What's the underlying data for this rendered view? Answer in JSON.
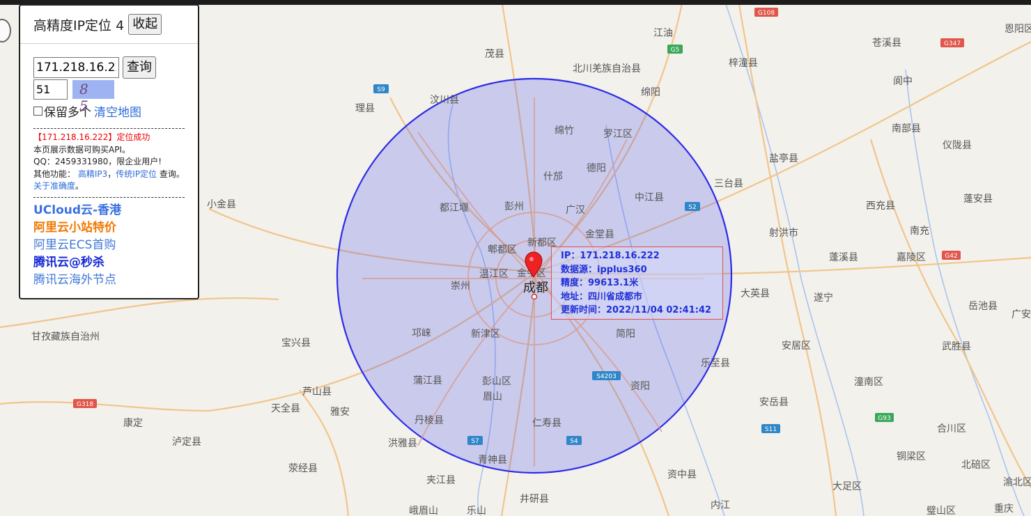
{
  "panel": {
    "title": "高精度IP定位 4",
    "collapse_label": "收起",
    "ip_value": "171.218.16.222",
    "query_label": "查询",
    "code_value": "51",
    "captcha_text": "8 5",
    "keep_label": "保留多个",
    "clear_label": "清空地图",
    "result_text": "【171.218.16.222】定位成功",
    "line1": "本页展示数据可购买API。",
    "line2": "QQ：2459331980，限企业用户!",
    "line3_prefix": "其他功能：",
    "link_hp": "高精IP3",
    "sep": "，",
    "link_trad": "传统IP定位",
    "line3_suffix": "查询。",
    "link_accuracy": "关于准确度",
    "line3_end": "。",
    "ads": [
      "UCloud云-香港",
      "阿里云小站特价",
      "阿里云ECS首购",
      "腾讯云@秒杀",
      "腾讯云海外节点"
    ]
  },
  "infobox": {
    "ip": "IP：171.218.16.222",
    "source": "数据源：ipplus360",
    "accuracy": "精度：99613.1米",
    "address": "地址：四川省成都市",
    "updated": "更新时间：2022/11/04 02:41:42"
  },
  "map": {
    "center_city": "成都",
    "accuracy_meters": 99613.1,
    "circle_color": "#2b2be8",
    "circle_fill": "#c8caf6",
    "place_labels": [
      "茂县",
      "北川羌族自治县",
      "江油",
      "梓潼县",
      "苍溪县",
      "恩阳区",
      "汶川县",
      "理县",
      "绵阳",
      "阆中",
      "绵竹",
      "罗江区",
      "南部县",
      "盐亭县",
      "仪陇县",
      "什邡",
      "德阳",
      "三台县",
      "都江堰",
      "彭州",
      "广汉",
      "中江县",
      "西充县",
      "蓬安县",
      "金堂县",
      "射洪市",
      "南充",
      "郫都区",
      "新都区",
      "金牛区",
      "蓬溪县",
      "嘉陵区",
      "温江区",
      "崇州",
      "成都",
      "大英县",
      "遂宁",
      "岳池县",
      "广安",
      "甘孜藏族自治州",
      "宝兴县",
      "邛崃",
      "新津区",
      "简阳",
      "安居区",
      "武胜县",
      "乐至县",
      "蒲江县",
      "彭山区",
      "芦山县",
      "潼南区",
      "天全县",
      "雅安",
      "眉山",
      "资阳",
      "安岳县",
      "康定",
      "丹棱县",
      "泸定县",
      "洪雅县",
      "仁寿县",
      "合川区",
      "青神县",
      "荥经县",
      "铜梁区",
      "北碚区",
      "夹江县",
      "资中县",
      "井研县",
      "大足区",
      "渝北区",
      "峨眉山",
      "乐山",
      "内江",
      "璧山区",
      "重庆",
      "小金县"
    ],
    "road_shields": [
      "G108",
      "G5",
      "G347",
      "S9",
      "S2",
      "G42",
      "S4203",
      "G318",
      "G93",
      "S11",
      "S7",
      "S4"
    ]
  }
}
